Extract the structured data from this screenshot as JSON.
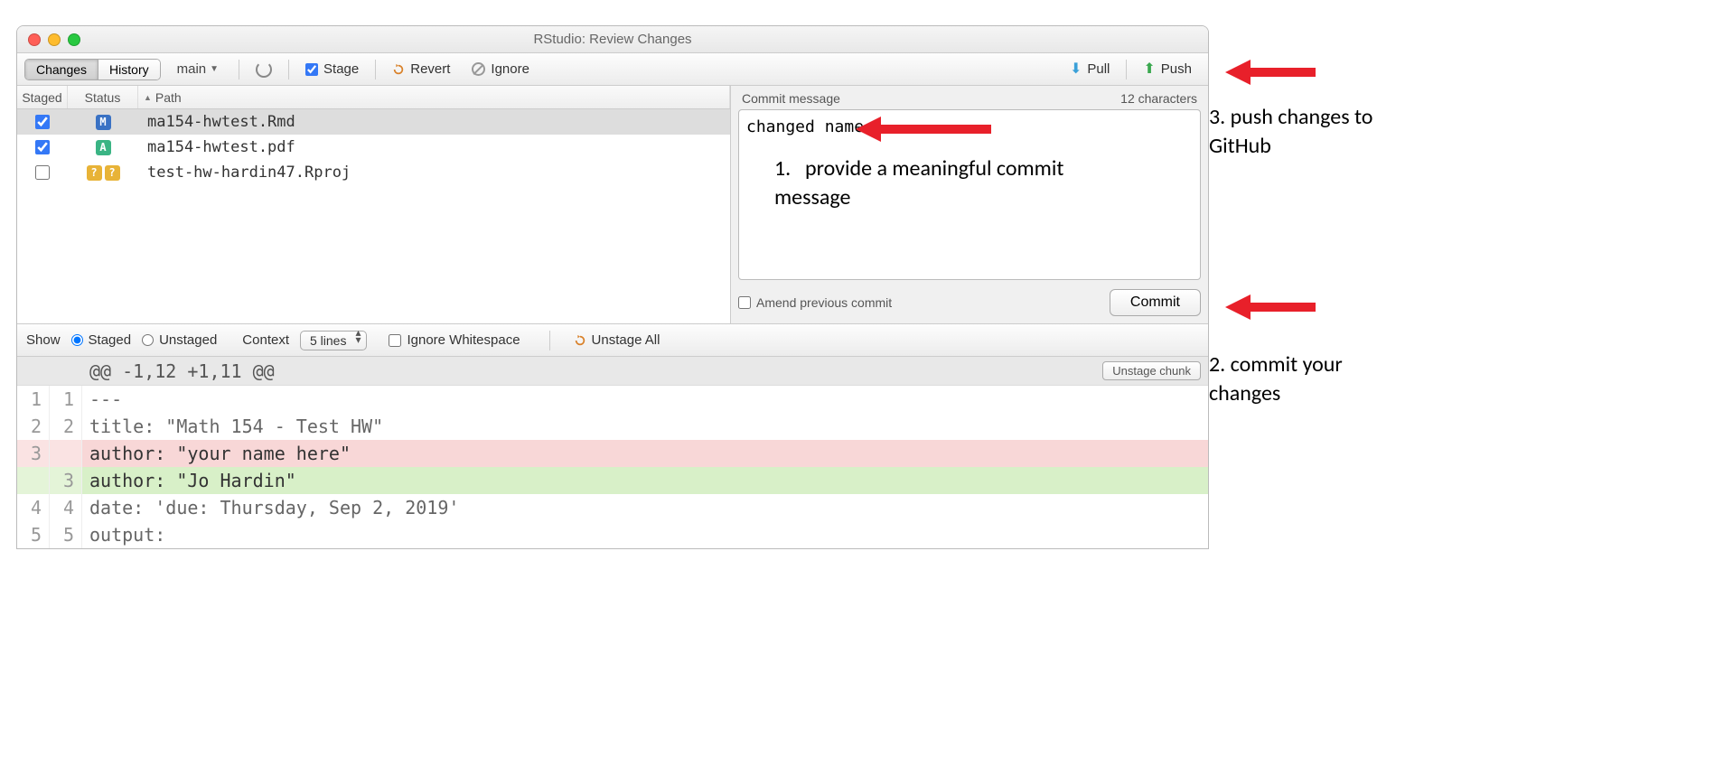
{
  "window": {
    "title": "RStudio: Review Changes"
  },
  "toolbar": {
    "tab_changes": "Changes",
    "tab_history": "History",
    "branch": "main",
    "stage": "Stage",
    "revert": "Revert",
    "ignore": "Ignore",
    "pull": "Pull",
    "push": "Push"
  },
  "file_panel": {
    "headers": {
      "staged": "Staged",
      "status": "Status",
      "path": "Path"
    },
    "files": [
      {
        "staged": true,
        "status": [
          "M"
        ],
        "path": "ma154-hwtest.Rmd",
        "selected": true
      },
      {
        "staged": true,
        "status": [
          "A"
        ],
        "path": "ma154-hwtest.pdf",
        "selected": false
      },
      {
        "staged": false,
        "status": [
          "?",
          "?"
        ],
        "path": "test-hw-hardin47.Rproj",
        "selected": false
      }
    ]
  },
  "commit": {
    "label": "Commit message",
    "char_count": "12 characters",
    "message": "changed name",
    "amend": "Amend previous commit",
    "button": "Commit"
  },
  "diff_toolbar": {
    "show": "Show",
    "staged": "Staged",
    "unstaged": "Unstaged",
    "context": "Context",
    "context_value": "5 lines",
    "ignore_ws": "Ignore Whitespace",
    "unstage_all": "Unstage All"
  },
  "diff": {
    "hunk": "@@ -1,12 +1,11 @@",
    "unstage_chunk": "Unstage chunk",
    "lines": [
      {
        "old": "1",
        "new": "1",
        "type": "ctx",
        "text": "---"
      },
      {
        "old": "2",
        "new": "2",
        "type": "ctx",
        "text": "title: \"Math 154 - Test HW\""
      },
      {
        "old": "3",
        "new": "",
        "type": "del",
        "text": "author: \"your name here\""
      },
      {
        "old": "",
        "new": "3",
        "type": "add",
        "text": "author: \"Jo Hardin\""
      },
      {
        "old": "4",
        "new": "4",
        "type": "ctx",
        "text": "date: 'due: Thursday, Sep 2, 2019'"
      },
      {
        "old": "5",
        "new": "5",
        "type": "ctx",
        "text": "output:"
      }
    ]
  },
  "annotations": {
    "a1_num": "1.",
    "a1_text": "provide a meaningful commit message",
    "a2": "2. commit your changes",
    "a3": "3. push changes to GitHub"
  }
}
